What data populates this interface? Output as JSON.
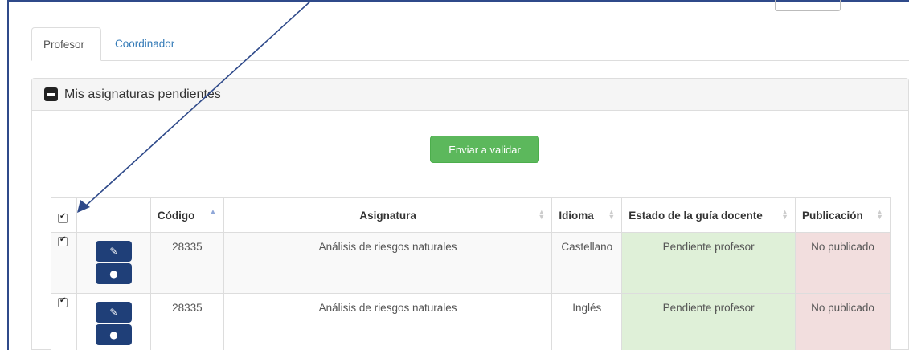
{
  "tabs": [
    {
      "label": "Profesor"
    },
    {
      "label": "Coordinador"
    }
  ],
  "panel": {
    "title": "Mis asignaturas pendientes"
  },
  "actions": {
    "send_label": "Enviar a validar"
  },
  "table": {
    "headers": [
      "Código",
      "Asignatura",
      "Idioma",
      "Estado de la guía docente",
      "Publicación"
    ],
    "rows": [
      {
        "codigo": "28335",
        "asignatura": "Análisis de riesgos naturales",
        "idioma": "Castellano",
        "estado": "Pendiente profesor",
        "publicacion": "No publicado"
      },
      {
        "codigo": "28335",
        "asignatura": "Análisis de riesgos naturales",
        "idioma": "Inglés",
        "estado": "Pendiente profesor",
        "publicacion": "No publicado"
      }
    ]
  },
  "colors": {
    "accent": "#337ab7",
    "send_button": "#5cb85c",
    "icon_button": "#1f3f78",
    "status_ok": "#dff0d8",
    "status_bad": "#f2dede",
    "annotation_arrow": "#2f4a8a"
  },
  "icons": {
    "edit": "edit-icon",
    "view": "eye-icon",
    "collapse": "minus-square-icon"
  }
}
